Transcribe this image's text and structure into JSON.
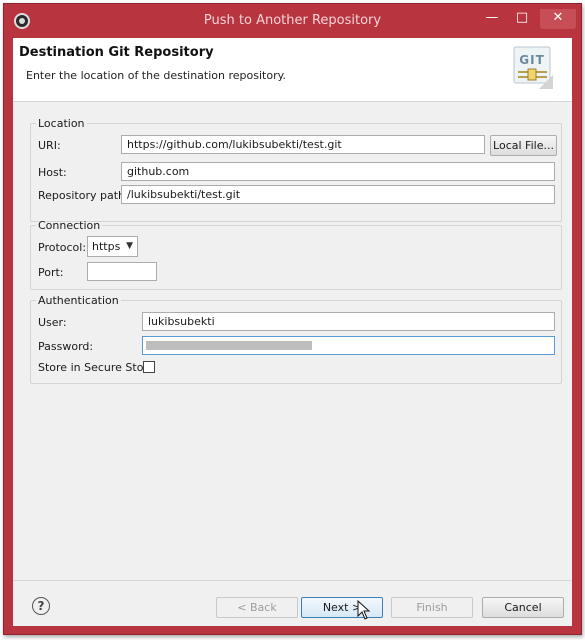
{
  "window": {
    "title": "Push to Another Repository",
    "controls": {
      "minimize": "—",
      "maximize": "□",
      "close": "✕"
    }
  },
  "banner": {
    "title": "Destination Git Repository",
    "description": "Enter the location of the destination repository.",
    "logo_text": "GIT"
  },
  "location": {
    "legend": "Location",
    "uri_label": "URI:",
    "uri_value": "https://github.com/lukibsubekti/test.git",
    "local_file_button": "Local File...",
    "host_label": "Host:",
    "host_value": "github.com",
    "path_label": "Repository path:",
    "path_value": "/lukibsubekti/test.git"
  },
  "connection": {
    "legend": "Connection",
    "protocol_label": "Protocol:",
    "protocol_value": "https",
    "port_label": "Port:",
    "port_value": ""
  },
  "authentication": {
    "legend": "Authentication",
    "user_label": "User:",
    "user_value": "lukibsubekti",
    "password_label": "Password:",
    "secure_store_label": "Store in Secure Store",
    "secure_store_checked": false
  },
  "footer": {
    "help_icon": "?",
    "back_button": "< Back",
    "next_button": "Next >",
    "finish_button": "Finish",
    "cancel_button": "Cancel"
  },
  "colors": {
    "title_bar": "#b8343f",
    "dialog_background": "#f0f0f0",
    "focus_border": "#5b9bd5"
  },
  "icons": [
    "eclipse-app-icon",
    "git-logo-icon",
    "help-icon",
    "mouse-cursor-icon"
  ]
}
